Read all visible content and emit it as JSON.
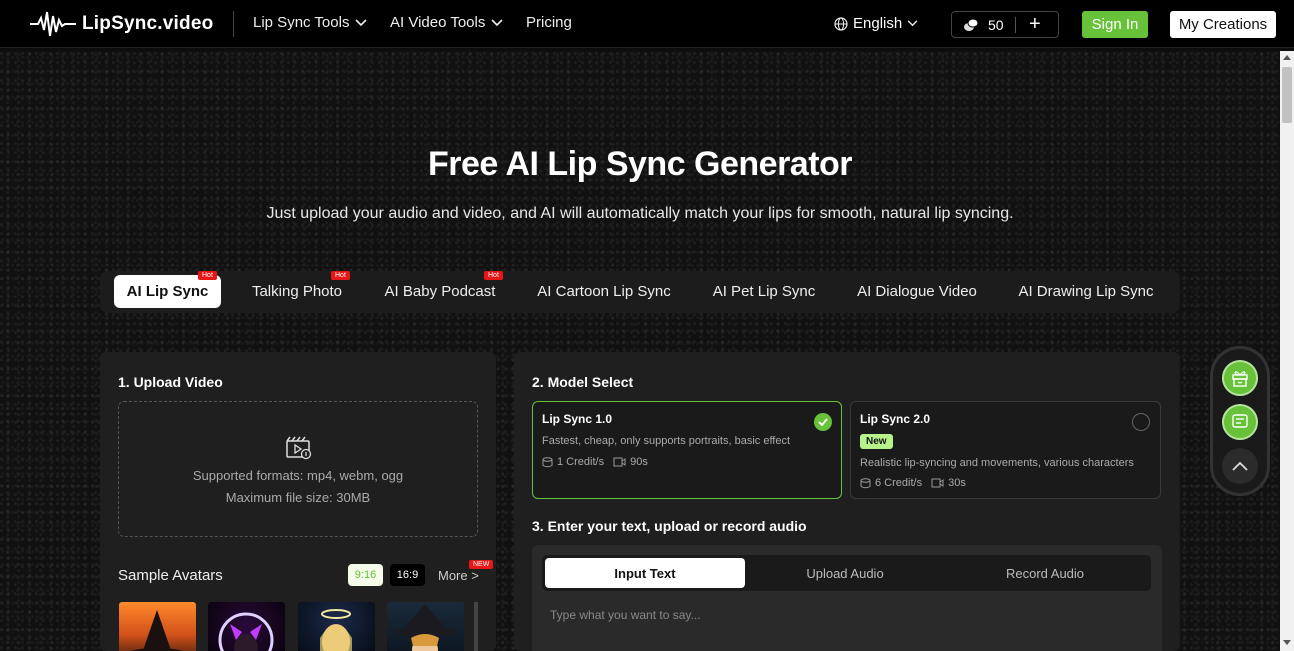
{
  "header": {
    "logo_text": "LipSync.video",
    "nav": [
      {
        "label": "Lip Sync Tools",
        "has_dropdown": true
      },
      {
        "label": "AI Video Tools",
        "has_dropdown": true
      },
      {
        "label": "Pricing",
        "has_dropdown": false
      }
    ],
    "language": "English",
    "credits": "50",
    "sign_in": "Sign In",
    "my_creations": "My Creations"
  },
  "hero": {
    "title": "Free AI Lip Sync Generator",
    "subtitle": "Just upload your audio and video, and AI will automatically match your lips for smooth, natural lip syncing."
  },
  "tabs": [
    {
      "label": "AI Lip Sync",
      "badge": "Hot",
      "active": true
    },
    {
      "label": "Talking Photo",
      "badge": "Hot",
      "active": false
    },
    {
      "label": "AI Baby Podcast",
      "badge": "Hot",
      "active": false
    },
    {
      "label": "AI Cartoon Lip Sync",
      "badge": "",
      "active": false
    },
    {
      "label": "AI Pet Lip Sync",
      "badge": "",
      "active": false
    },
    {
      "label": "AI Dialogue Video",
      "badge": "",
      "active": false
    },
    {
      "label": "AI Drawing Lip Sync",
      "badge": "",
      "active": false
    }
  ],
  "upload": {
    "title": "1. Upload Video",
    "formats": "Supported formats: mp4, webm, ogg",
    "max_size": "Maximum file size: 30MB"
  },
  "samples": {
    "label": "Sample Avatars",
    "ratio_a": "9:16",
    "ratio_b": "16:9",
    "more": "More >",
    "new_badge": "NEW"
  },
  "model_select": {
    "title": "2. Model Select",
    "models": [
      {
        "name": "Lip Sync 1.0",
        "desc": "Fastest, cheap, only supports portraits, basic effect",
        "credits": "1 Credit/s",
        "duration": "90s",
        "selected": true,
        "badge": ""
      },
      {
        "name": "Lip Sync 2.0",
        "desc": "Realistic lip-syncing and movements, various characters",
        "credits": "6 Credit/s",
        "duration": "30s",
        "selected": false,
        "badge": "New"
      }
    ]
  },
  "audio": {
    "title": "3. Enter your text, upload or record audio",
    "tabs": [
      "Input Text",
      "Upload Audio",
      "Record Audio"
    ],
    "placeholder": "Type what you want to say..."
  },
  "colors": {
    "accent": "#67c23a",
    "hot_badge": "#e81717"
  }
}
